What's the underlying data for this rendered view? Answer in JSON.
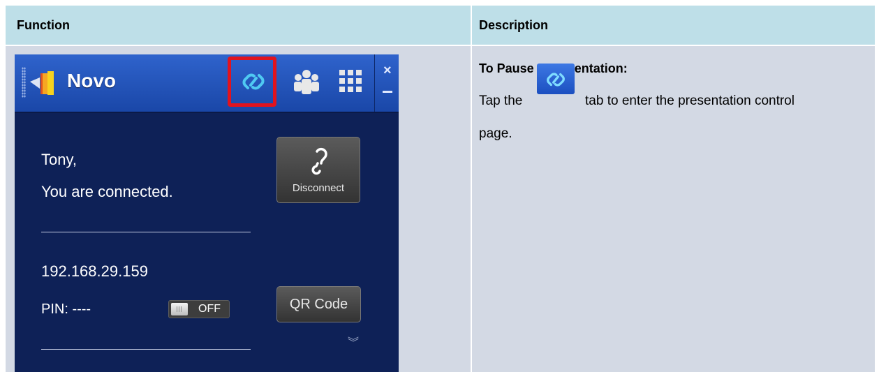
{
  "table": {
    "headers": {
      "function": "Function",
      "description": "Description"
    }
  },
  "novo_panel": {
    "app_name": "Novo",
    "tabs": [
      "link-icon",
      "people-icon",
      "grid-icon"
    ],
    "window_close": "×",
    "greeting": "Tony,",
    "status": "You are connected.",
    "disconnect_label": "Disconnect",
    "ip_address": "192.168.29.159",
    "pin_label": "PIN: ----",
    "pin_toggle_state": "OFF",
    "qr_button_label": "QR Code",
    "more_icon": "»"
  },
  "description": {
    "title": "To Pause a presentation:",
    "line1_before_icon": "Tap the",
    "line1_after_icon": "tab to enter the presentation control",
    "line2": "page."
  },
  "colors": {
    "header_bg": "#bedfe8",
    "body_bg": "#d3d9e4",
    "panel_bg": "#0e2157",
    "titlebar": "#2f63cc",
    "highlight": "#e1131e"
  }
}
